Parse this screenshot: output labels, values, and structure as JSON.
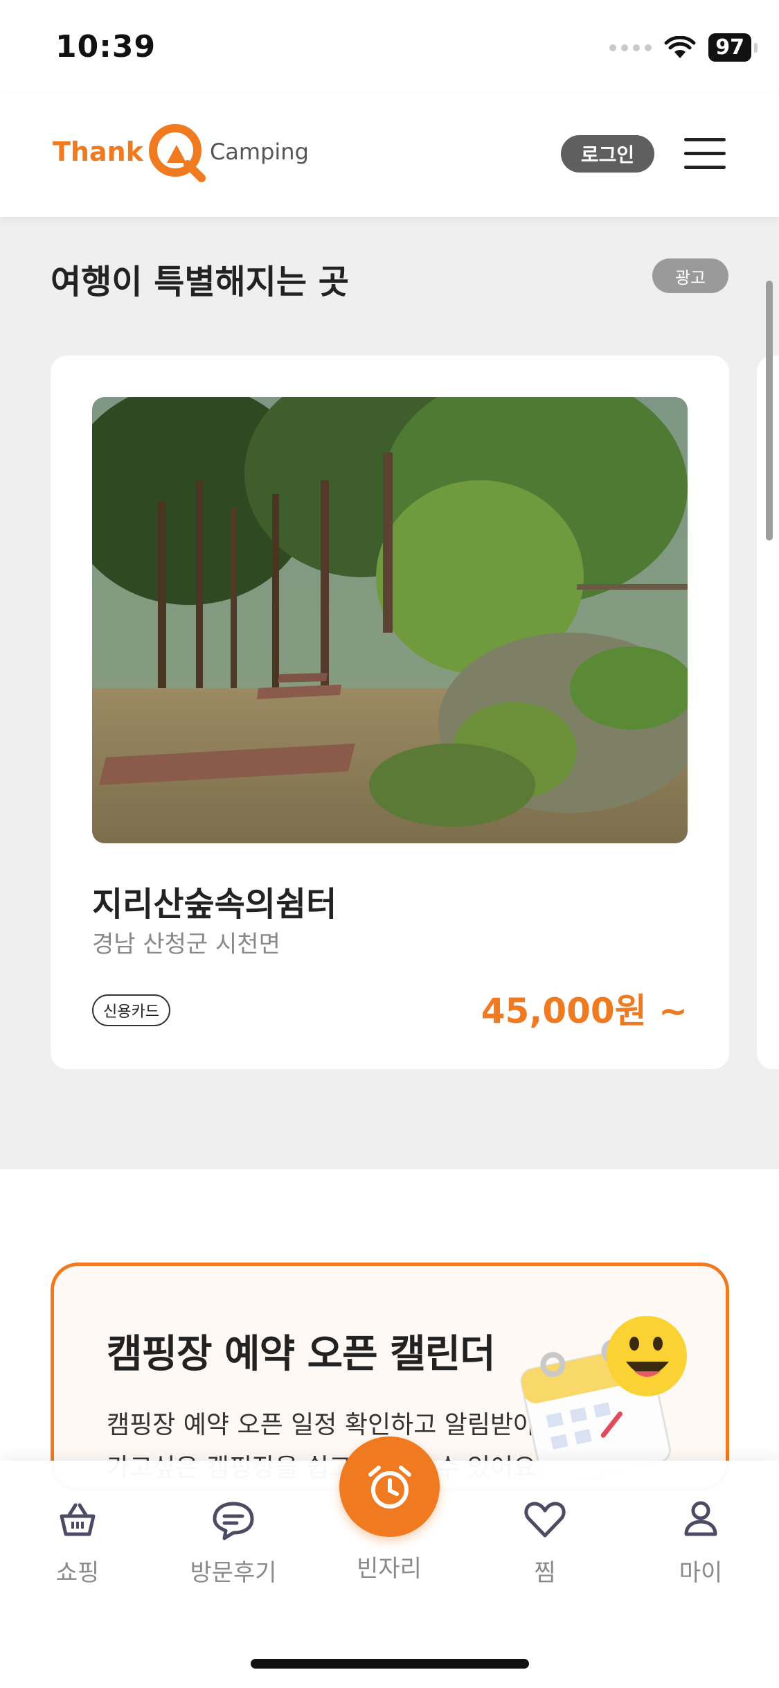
{
  "status_bar": {
    "time": "10:39",
    "battery": "97"
  },
  "header": {
    "logo": {
      "part1": "Thank",
      "part2": "Q",
      "part3": "Camping"
    },
    "login_label": "로그인"
  },
  "ad_section": {
    "title": "여행이 특별해지는 곳",
    "badge": "광고",
    "card": {
      "name": "지리산숲속의쉼터",
      "location": "경남 산청군 시천면",
      "tag": "신용카드",
      "price": "45,000원 ~"
    }
  },
  "calendar_banner": {
    "title": "캠핑장 예약 오픈 캘린더",
    "description": "캠핑장 예약 오픈 일정 확인하고 알림받아 보세요!",
    "description2": "가고싶은 캠핑장을 쉽고 예약할 수 있어요"
  },
  "bottom_nav": {
    "items": [
      {
        "label": "쇼핑",
        "icon": "basket-icon"
      },
      {
        "label": "방문후기",
        "icon": "chat-bubble-icon"
      },
      {
        "label": "빈자리",
        "icon": "alarm-clock-icon"
      },
      {
        "label": "찜",
        "icon": "heart-icon"
      },
      {
        "label": "마이",
        "icon": "person-icon"
      }
    ]
  },
  "colors": {
    "accent": "#ef7a20",
    "background_grey": "#efefef",
    "badge_grey": "#5f5f5f"
  }
}
